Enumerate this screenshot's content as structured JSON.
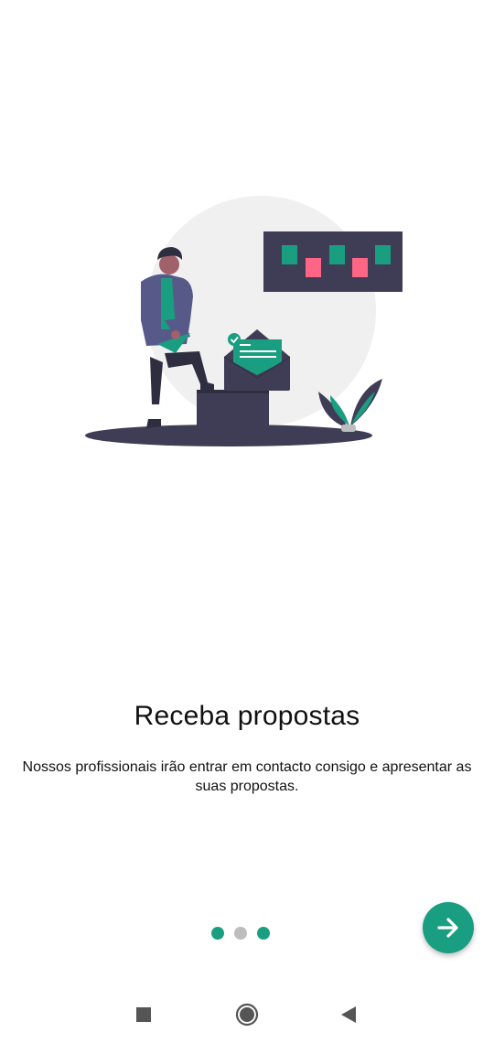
{
  "onboarding": {
    "title": "Receba propostas",
    "description": "Nossos profissionais irão entrar em contacto consigo e apresentar as suas propostas."
  },
  "pager": {
    "total_pages": 3,
    "current_page": 2
  },
  "next_button": {
    "icon": "arrow-right-icon"
  },
  "navigation_bar": {
    "icons": [
      "recents-square-icon",
      "home-circle-icon",
      "back-triangle-icon"
    ]
  },
  "colors": {
    "accent": "#1a9e81",
    "inactive_dot": "#bdbdbd",
    "dark": "#3f3d56",
    "pink": "#ff6584",
    "background": "#ffffff"
  }
}
